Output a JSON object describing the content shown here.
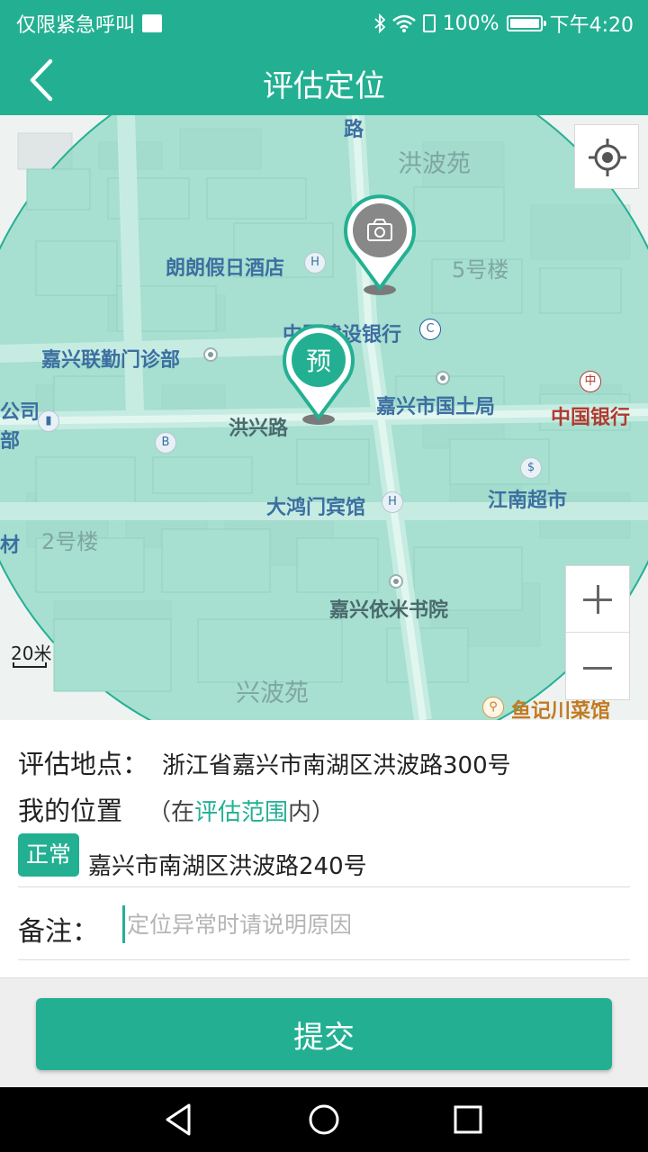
{
  "status_bar": {
    "carrier_text": "仅限紧急呼叫",
    "battery_percent": "100%",
    "time": "下午4:20",
    "icons": [
      "mail-icon",
      "bluetooth-icon",
      "wifi-icon",
      "sim-icon",
      "battery-icon"
    ]
  },
  "header": {
    "title": "评估定位",
    "back_icon": "chevron-left-icon"
  },
  "map": {
    "labels": {
      "hongbo_yuan": "洪波苑",
      "langlang_hotel": "朗朗假日酒店",
      "building5": "5号楼",
      "ccb": "中国建设银行",
      "clinic": "嘉兴联勤门诊部",
      "company": "公司",
      "bu": "部",
      "hongxing_road": "洪兴路",
      "land_bureau": "嘉兴市国土局",
      "boc": "中国银行",
      "dahongmen_hotel": "大鸿门宾馆",
      "jiangnan_market": "江南超市",
      "building2": "2号楼",
      "cai": "材",
      "yimi_bookstore": "嘉兴依米书院",
      "xingbo_yuan": "兴波苑",
      "yuji_restaurant": "鱼记川菜馆",
      "road_top": "路"
    },
    "scale": "20米",
    "pins": {
      "camera_pin_icon": "camera-icon",
      "preset_pin_text": "预"
    },
    "controls": {
      "locate_icon": "crosshair-icon",
      "zoom_in_icon": "plus-icon",
      "zoom_out_icon": "minus-icon"
    },
    "colors": {
      "range_fill": "#8fd8c4",
      "accent": "#23b092"
    }
  },
  "info": {
    "address_label": "评估地点：",
    "address_value": "浙江省嘉兴市南湖区洪波路300号",
    "position_label": "我的位置",
    "position_note_prefix": "（在",
    "position_note_highlight": "评估范围",
    "position_note_suffix": "内）",
    "status_tag": "正常",
    "current_address": "嘉兴市南湖区洪波路240号",
    "remark_label": "备注：",
    "remark_placeholder": "定位异常时请说明原因",
    "remark_value": ""
  },
  "footer": {
    "submit_label": "提交"
  },
  "navbar": {
    "back_icon": "triangle-back-icon",
    "home_icon": "circle-home-icon",
    "recent_icon": "square-recent-icon"
  }
}
